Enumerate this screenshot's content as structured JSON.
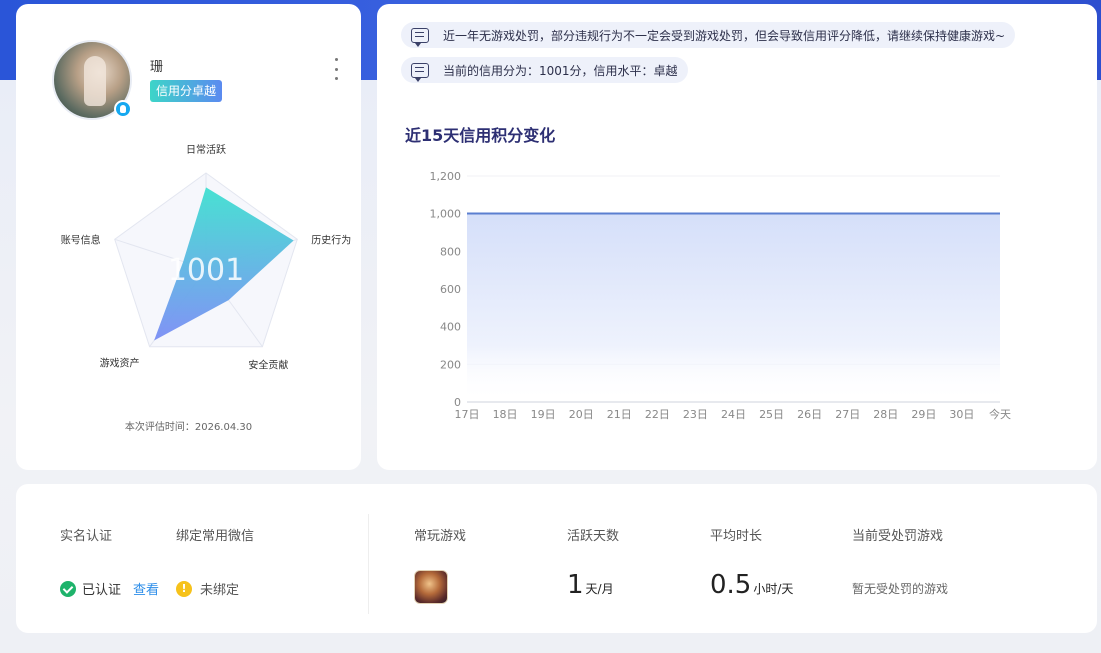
{
  "profile": {
    "nickname": "珊",
    "credit_tag": "信用分卓越",
    "score": "1001",
    "radar_labels": [
      "日常活跃",
      "历史行为",
      "安全贡献",
      "游戏资产",
      "账号信息"
    ],
    "radar_values": [
      0.85,
      0.96,
      0.4,
      0.92,
      0.25
    ],
    "eval_time": "本次评估时间：2026.04.30"
  },
  "notices": [
    "近一年无游戏处罚，部分违规行为不一定会受到游戏处罚，但会导致信用评分降低，请继续保持健康游戏~",
    "当前的信用分为：1001分，信用水平：卓越"
  ],
  "chart_title": "近15天信用积分变化",
  "chart_data": {
    "type": "area",
    "categories": [
      "17日",
      "18日",
      "19日",
      "20日",
      "21日",
      "22日",
      "23日",
      "24日",
      "25日",
      "26日",
      "27日",
      "28日",
      "29日",
      "30日",
      "今天"
    ],
    "values": [
      1001,
      1001,
      1001,
      1001,
      1001,
      1001,
      1001,
      1001,
      1001,
      1001,
      1001,
      1001,
      1001,
      1001,
      1001
    ],
    "ylim": [
      0,
      1200
    ],
    "yticks": [
      "0",
      "200",
      "400",
      "600",
      "800",
      "1,000",
      "1,200"
    ],
    "grid": true,
    "line_color": "#5b7fd0",
    "fill_color": "#dbe4fb"
  },
  "bottom": {
    "real_name_label": "实名认证",
    "wechat_label": "绑定常用微信",
    "real_name_status": "已认证",
    "view_link": "查看",
    "wechat_status": "未绑定",
    "frequent_game_label": "常玩游戏",
    "active_days_label": "活跃天数",
    "avg_duration_label": "平均时长",
    "punished_game_label": "当前受处罚游戏",
    "active_days_value": "1",
    "active_days_unit": "天/月",
    "avg_duration_value": "0.5",
    "avg_duration_unit": "小时/天",
    "no_punish_text": "暂无受处罚的游戏"
  },
  "colors": {
    "accent": "#2d8ee9",
    "success": "#1eb36b",
    "warning": "#f6c21b",
    "title": "#2d2f73"
  },
  "icons": {
    "more": "more-vertical-icon",
    "message": "message-icon",
    "check": "check-circle-icon",
    "warning": "warning-circle-icon",
    "qq": "qq-icon"
  }
}
